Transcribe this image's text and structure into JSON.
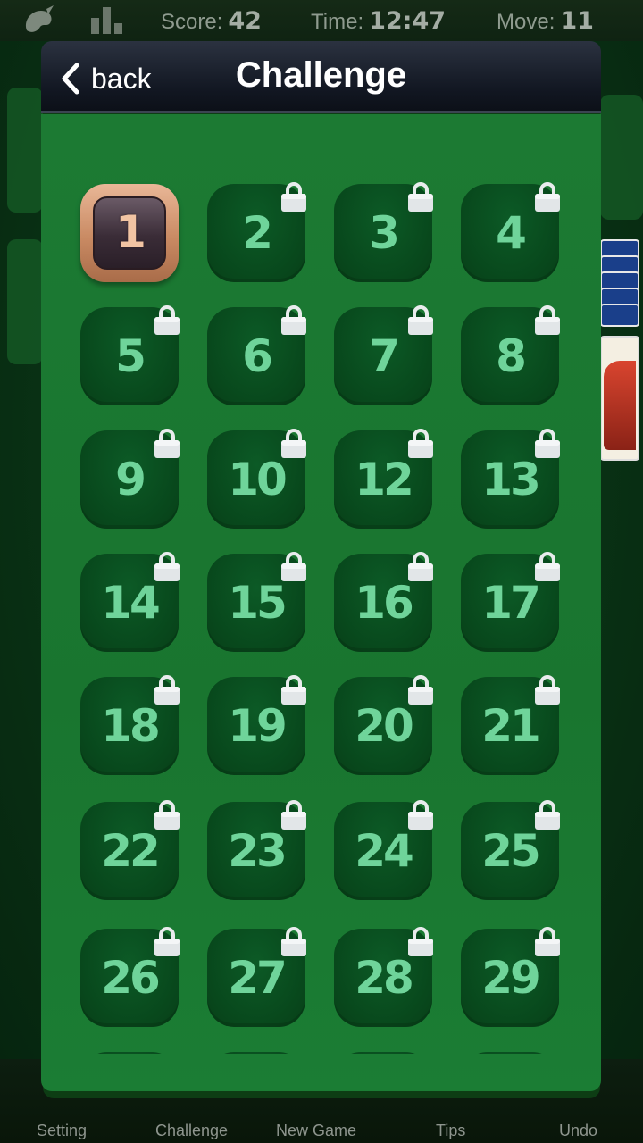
{
  "status_bar": {
    "score_label": "Score:",
    "score_value": "42",
    "time_label": "Time:",
    "time_value": "12:47",
    "move_label": "Move:",
    "move_value": "11",
    "icons": [
      "theme-icon",
      "stats-icon"
    ]
  },
  "dialog": {
    "back_label": "back",
    "title": "Challenge",
    "current_level": "1",
    "levels": [
      "1",
      "2",
      "3",
      "4",
      "5",
      "6",
      "7",
      "8",
      "9",
      "10",
      "12",
      "13",
      "14",
      "15",
      "16",
      "17",
      "18",
      "19",
      "20",
      "21",
      "22",
      "23",
      "24",
      "25",
      "26",
      "27",
      "28",
      "29"
    ],
    "locked_levels": [
      "2",
      "3",
      "4",
      "5",
      "6",
      "7",
      "8",
      "9",
      "10",
      "12",
      "13",
      "14",
      "15",
      "16",
      "17",
      "18",
      "19",
      "20",
      "21",
      "22",
      "23",
      "24",
      "25",
      "26",
      "27",
      "28",
      "29"
    ]
  },
  "bottom_bar": {
    "items": [
      "Setting",
      "Challenge",
      "New Game",
      "Tips",
      "Undo"
    ]
  },
  "colors": {
    "dialog_green": "#1b7a32",
    "tile_green": "#08481c",
    "number_green": "#6fd49a",
    "current_tile_bronze": "#c98a63"
  }
}
